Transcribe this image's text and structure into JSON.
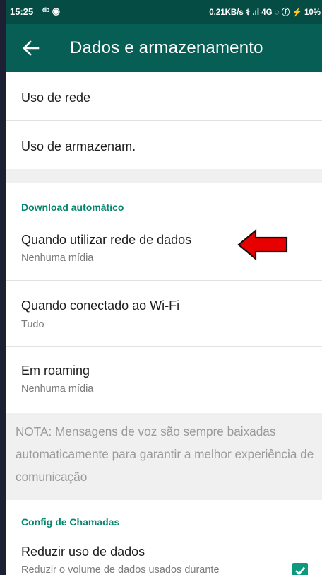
{
  "status_bar": {
    "time": "15:25",
    "left_icons": "ᵈᵇ ◉",
    "right_text": "0,21KB/s ⚕ .ıl 4G ◌ ⓕ ⚡ 10%"
  },
  "app_bar": {
    "title": "Dados e armazenamento"
  },
  "network": {
    "usage_label": "Uso de rede",
    "storage_label": "Uso de armazenam."
  },
  "auto_download": {
    "header": "Download automático",
    "items": [
      {
        "title": "Quando utilizar rede de dados",
        "subtitle": "Nenhuma mídia"
      },
      {
        "title": "Quando conectado ao Wi-Fi",
        "subtitle": "Tudo"
      },
      {
        "title": "Em roaming",
        "subtitle": "Nenhuma mídia"
      }
    ]
  },
  "note": {
    "text": "NOTA: Mensagens de voz são sempre baixadas automaticamente para garantir a melhor experiência de comunicação"
  },
  "calls": {
    "header": "Config de Chamadas",
    "reduce_title": "Reduzir uso de dados",
    "reduce_subtitle": "Reduzir o volume de dados usados durante",
    "reduce_checked": true
  },
  "colors": {
    "app_bar": "#075e54",
    "status_bar": "#054d44",
    "accent": "#07866f",
    "annotation_arrow": "#e60000"
  }
}
